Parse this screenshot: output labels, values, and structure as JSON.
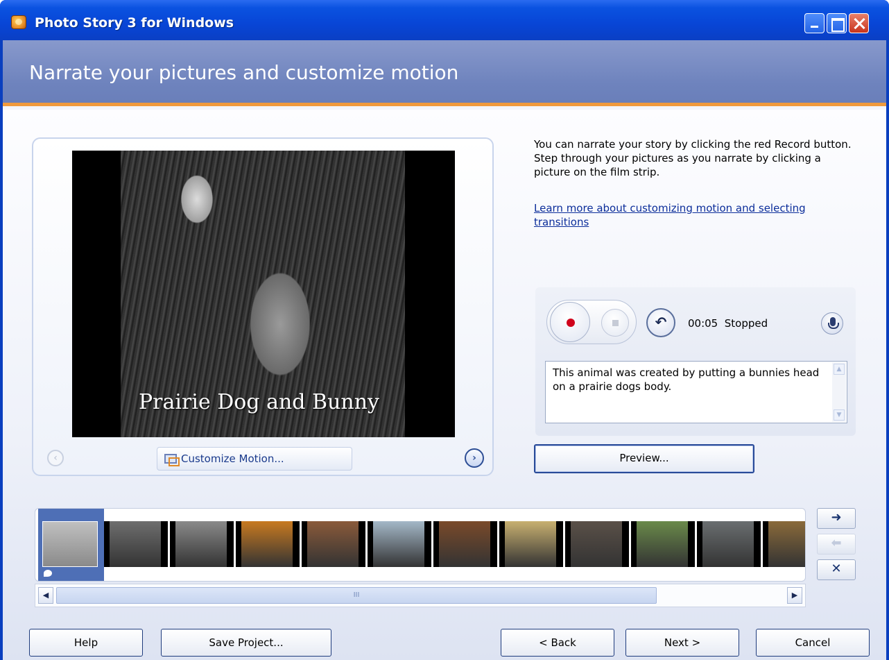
{
  "window": {
    "title": "Photo Story 3 for Windows",
    "icon": "photo-story-app-icon"
  },
  "header": {
    "title": "Narrate your pictures and customize motion"
  },
  "preview": {
    "caption": "Prairie Dog and Bunny",
    "customize_label": "Customize Motion...",
    "prev_icon": "chevron-left-icon",
    "next_icon": "chevron-right-icon"
  },
  "instructions": {
    "text": "You can narrate your story by clicking the red Record button. Step through your pictures as you narrate by clicking a picture on the film strip.",
    "link": "Learn more about customizing motion and selecting transitions"
  },
  "narration": {
    "time": "00:05",
    "status": "Stopped",
    "notes": "This animal was created by putting a bunnies head on a prairie dogs body.",
    "colors": {
      "record": "#d0021b"
    }
  },
  "preview_button": "Preview...",
  "filmstrip": {
    "thumbnails": [
      {
        "label": "thumb-1-prairie-dog-bunny",
        "color": "#9c9c9c"
      },
      {
        "label": "thumb-2-bird",
        "color": "#6e6e6e"
      },
      {
        "label": "thumb-3-cat",
        "color": "#8a8a8a"
      },
      {
        "label": "thumb-4-squirrel",
        "color": "#c87a20"
      },
      {
        "label": "thumb-5-owl",
        "color": "#8a5a3a"
      },
      {
        "label": "thumb-6-penguin",
        "color": "#a4b8c8"
      },
      {
        "label": "thumb-7-bear",
        "color": "#7a4a2a"
      },
      {
        "label": "thumb-8-duck",
        "color": "#c8b070"
      },
      {
        "label": "thumb-9-otter",
        "color": "#5a5048"
      },
      {
        "label": "thumb-10-horse",
        "color": "#6a8a4a"
      },
      {
        "label": "thumb-11-seal",
        "color": "#6a6e70"
      },
      {
        "label": "thumb-12-koala",
        "color": "#8a6a3a"
      }
    ]
  },
  "scrollbar": {
    "grip": "III"
  },
  "footer": {
    "help": "Help",
    "save": "Save Project...",
    "back": "< Back",
    "next": "Next >",
    "cancel": "Cancel"
  }
}
